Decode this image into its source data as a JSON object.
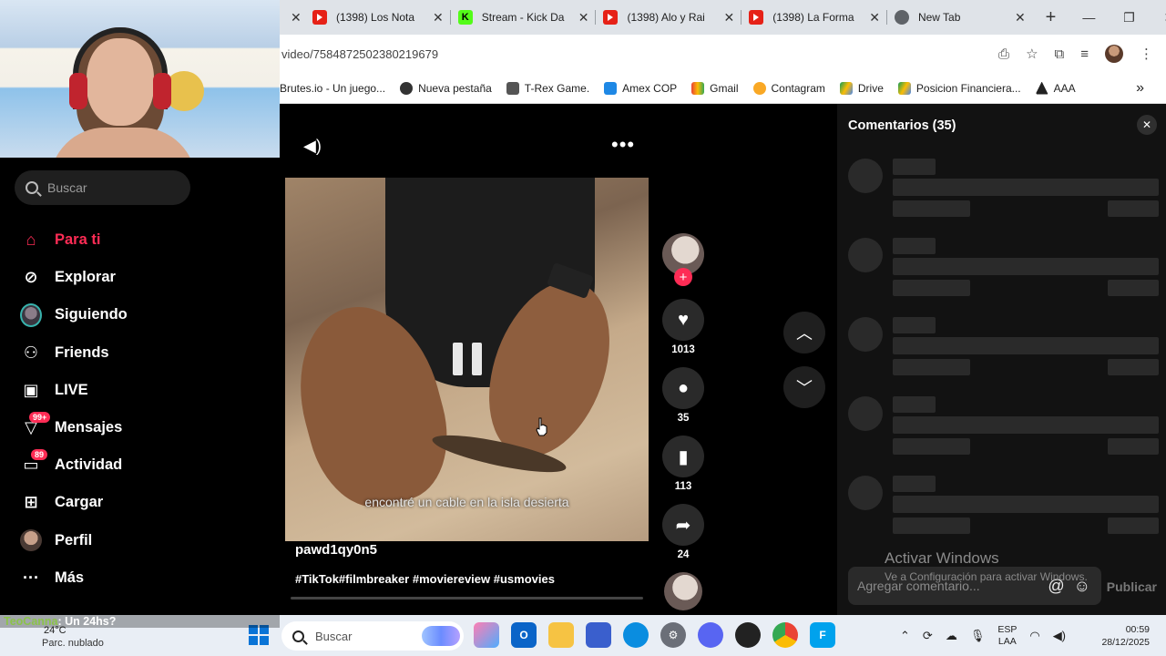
{
  "browser": {
    "tabs": [
      {
        "title": "(1398) Los Nota",
        "favicon": "youtube"
      },
      {
        "title": "Stream - Kick Da",
        "favicon": "kick"
      },
      {
        "title": "(1398) Alo y Rai",
        "favicon": "youtube"
      },
      {
        "title": "(1398) La Forma",
        "favicon": "youtube"
      },
      {
        "title": "New Tab",
        "favicon": "chrome"
      }
    ],
    "url": "video/7584872502380219679",
    "bookmarks": [
      {
        "label": "Brutes.io - Un juego..."
      },
      {
        "label": "Nueva pestaña"
      },
      {
        "label": "T-Rex Game."
      },
      {
        "label": "Amex COP"
      },
      {
        "label": "Gmail"
      },
      {
        "label": "Contagram"
      },
      {
        "label": "Drive"
      },
      {
        "label": "Posicion Financiera..."
      },
      {
        "label": "AAA"
      }
    ]
  },
  "sidebar": {
    "search_placeholder": "Buscar",
    "items": [
      {
        "label": "Para ti",
        "icon": "home-icon",
        "active": true
      },
      {
        "label": "Explorar",
        "icon": "compass-icon"
      },
      {
        "label": "Siguiendo",
        "icon": "avatar"
      },
      {
        "label": "Friends",
        "icon": "people-icon"
      },
      {
        "label": "LIVE",
        "icon": "tv-icon"
      },
      {
        "label": "Mensajes",
        "icon": "message-icon",
        "badge": "99+"
      },
      {
        "label": "Actividad",
        "icon": "inbox-icon",
        "badge": "89"
      },
      {
        "label": "Cargar",
        "icon": "plus-square-icon"
      },
      {
        "label": "Perfil",
        "icon": "avatar"
      },
      {
        "label": "Más",
        "icon": "more-icon"
      }
    ]
  },
  "video": {
    "subtitle": "encontré un cable en la isla desierta",
    "username": "pawd1qy0n5",
    "hashtags": "#TikTok#filmbreaker #moviereview #usmovies"
  },
  "actions": {
    "likes": "1013",
    "comments": "35",
    "saves": "113",
    "shares": "24"
  },
  "comments_panel": {
    "title": "Comentarios (35)",
    "input_placeholder": "Agregar comentario...",
    "publish_label": "Publicar"
  },
  "watermark": {
    "line1": "Activar Windows",
    "line2": "Ve a Configuración para activar Windows."
  },
  "chat": {
    "user": "TeoCanna",
    "message": ": Un 24hs?"
  },
  "taskbar": {
    "weather_temp": "24°C",
    "weather_desc": "Parc. nublado",
    "search_placeholder": "Buscar",
    "lang_line1": "ESP",
    "lang_line2": "LAA",
    "time": "00:59",
    "date": "28/12/2025"
  }
}
